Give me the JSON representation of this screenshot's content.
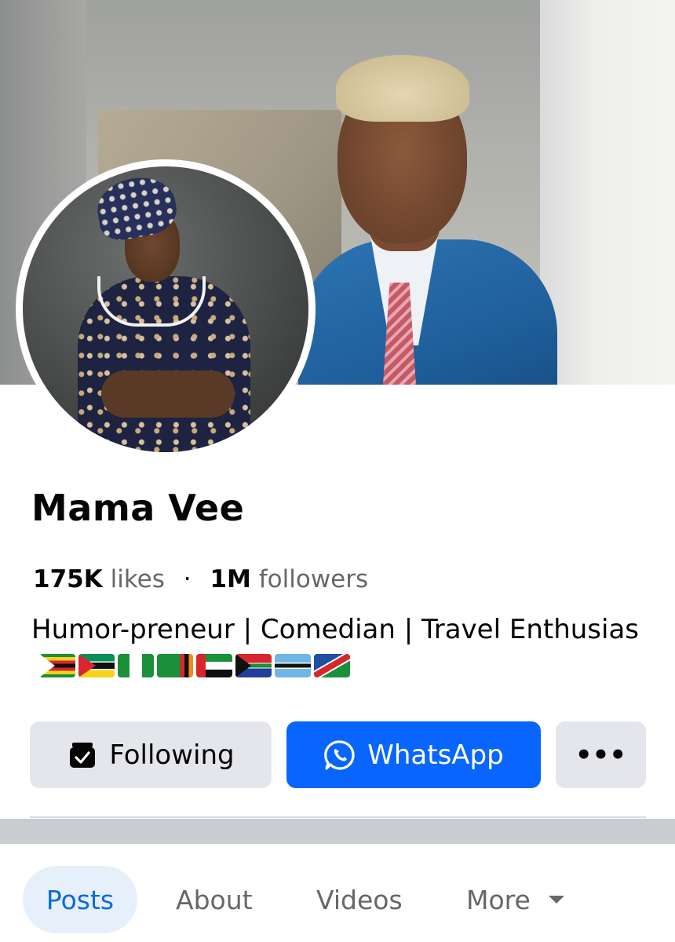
{
  "profile": {
    "name": "Mama Vee",
    "likes_count": "175K",
    "likes_label": "likes",
    "separator": "·",
    "followers_count": "1M",
    "followers_label": "followers",
    "bio": "Humor-preneur | Comedian | Travel Enthusias",
    "bio_flags": [
      "Zimbabwe flag",
      "Mozambique flag",
      "Nigeria flag",
      "Zambia flag",
      "UAE flag",
      "South Africa flag",
      "Botswana flag",
      "Namibia flag"
    ]
  },
  "actions": {
    "following_label": "Following",
    "whatsapp_label": "WhatsApp",
    "more_label": "•••"
  },
  "tabs": [
    {
      "label": "Posts",
      "active": true
    },
    {
      "label": "About"
    },
    {
      "label": "Videos"
    },
    {
      "label": "More"
    }
  ],
  "colors": {
    "accent": "#0866ff",
    "active_tab_text": "#0a6adf",
    "active_tab_bg": "#e6f0fb",
    "secondary_button_bg": "#e4e6eb"
  }
}
